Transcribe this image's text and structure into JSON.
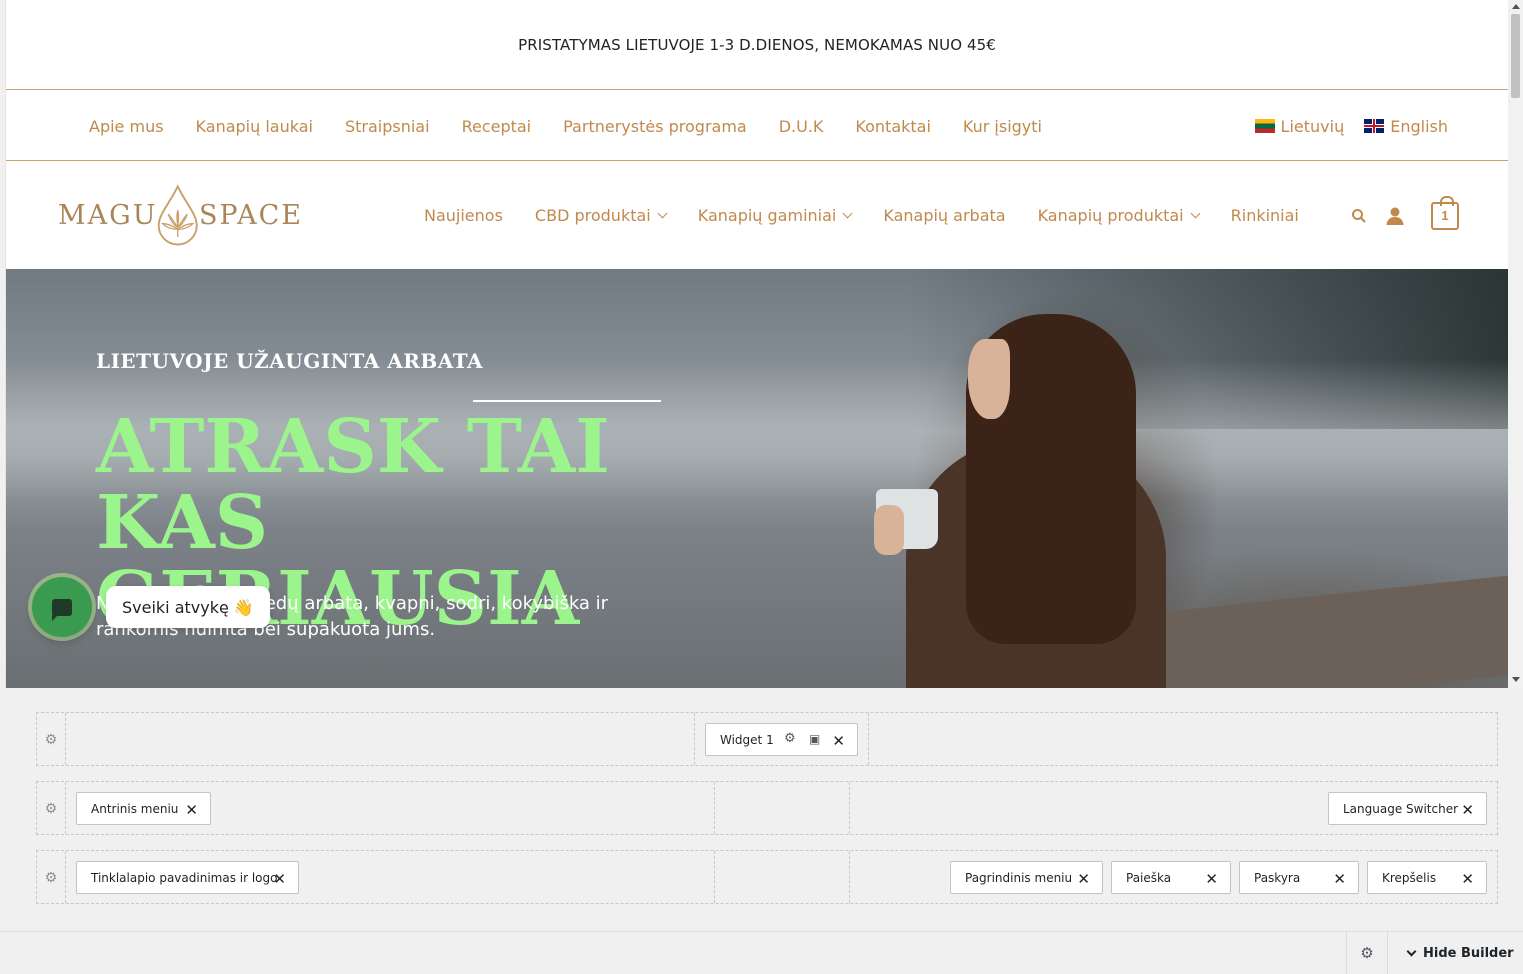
{
  "announcement": "PRISTATYMAS LIETUVOJE 1-3 D.DIENOS, NEMOKAMAS NUO 45€",
  "secondary_menu": [
    "Apie mus",
    "Kanapių laukai",
    "Straipsniai",
    "Receptai",
    "Partnerystės programa",
    "D.U.K",
    "Kontaktai",
    "Kur įsigyti"
  ],
  "languages": [
    {
      "label": "Lietuvių",
      "flag": "lt-flag-icon"
    },
    {
      "label": "English",
      "flag": "gb-flag-icon"
    }
  ],
  "logo": {
    "left": "MAGU",
    "right": "SPACE",
    "color": "#a9865a"
  },
  "main_menu": [
    {
      "label": "Naujienos",
      "dropdown": false
    },
    {
      "label": "CBD produktai",
      "dropdown": true
    },
    {
      "label": "Kanapių gaminiai",
      "dropdown": true
    },
    {
      "label": "Kanapių arbata",
      "dropdown": false
    },
    {
      "label": "Kanapių produktai",
      "dropdown": true
    },
    {
      "label": "Rinkiniai",
      "dropdown": false
    }
  ],
  "header_icons": {
    "search": "search-icon",
    "account": "user-icon",
    "cart": "cart-icon",
    "cart_count": "1"
  },
  "hero": {
    "subtitle": "LIETUVOJE UŽAUGINTA ARBATA",
    "title_line1": "ATRASK TAI KAS",
    "title_line2": "GERIAUSIA",
    "text": "Natūrali kanapių žiedų arbata, kvapni, sodri, kokybiška ir rankomis nuimta bei supakuota jums.",
    "title_color": "#9cf58c"
  },
  "chat": {
    "greeting": "Sveiki atvykę 👋"
  },
  "builder": {
    "row1": {
      "widgets": [
        {
          "label": "Widget 1"
        }
      ]
    },
    "row2": {
      "left": [
        {
          "label": "Antrinis meniu"
        }
      ],
      "right": [
        {
          "label": "Language Switcher"
        }
      ]
    },
    "row3": {
      "left": [
        {
          "label": "Tinklalapio pavadinimas ir logo"
        }
      ],
      "right": [
        {
          "label": "Pagrindinis meniu"
        },
        {
          "label": "Paieška"
        },
        {
          "label": "Paskyra"
        },
        {
          "label": "Krepšelis"
        }
      ]
    },
    "hide_label": "Hide Builder"
  },
  "colors": {
    "accent": "#c08a4e",
    "border": "#c9a16b"
  }
}
